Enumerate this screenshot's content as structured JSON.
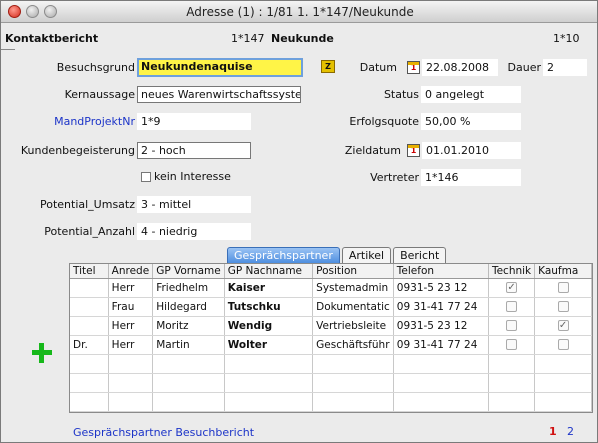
{
  "window": {
    "title": "Adresse (1) : 1/81 1.  1*147/Neukunde"
  },
  "header": {
    "section": "Kontaktbericht",
    "record": "1*147",
    "kind": "Neukunde",
    "counter": "1*10"
  },
  "form": {
    "besuchsgrund": {
      "label": "Besuchsgrund",
      "value": "Neukundenaquise"
    },
    "kernaussage": {
      "label": "Kernaussage",
      "value": "neues Warenwirtschaftssystem"
    },
    "mandprojekt": {
      "label": "MandProjektNr",
      "value": "1*9"
    },
    "kundenbegeisterung": {
      "label": "Kundenbegeisterung",
      "value": "2 - hoch"
    },
    "kein_interesse": {
      "label": "kein Interesse"
    },
    "potential_umsatz": {
      "label": "Potential_Umsatz",
      "value": "3 - mittel"
    },
    "potential_anzahl": {
      "label": "Potential_Anzahl",
      "value": "4 - niedrig"
    },
    "datum": {
      "label": "Datum",
      "value": "22.08.2008"
    },
    "dauer": {
      "label": "Dauer",
      "value": "2"
    },
    "status": {
      "label": "Status",
      "value": "0 angelegt"
    },
    "erfolgsquote": {
      "label": "Erfolgsquote",
      "value": "50,00 %"
    },
    "zieldatum": {
      "label": "Zieldatum",
      "value": "01.01.2010"
    },
    "vertreter": {
      "label": "Vertreter",
      "value": "1*146"
    },
    "cal_glyph": "1"
  },
  "tabs": [
    "Gesprächspartner",
    "Artikel",
    "Bericht"
  ],
  "table": {
    "columns": [
      "Titel",
      "Anrede",
      "GP Vorname",
      "GP Nachname",
      "Position",
      "Telefon",
      "Technik",
      "Kaufma"
    ],
    "rows": [
      {
        "titel": "",
        "anrede": "Herr",
        "vorname": "Friedhelm",
        "nachname": "Kaiser",
        "position": "Systemadmin",
        "telefon": "0931-5 23 12",
        "technik": true,
        "kauf": false
      },
      {
        "titel": "",
        "anrede": "Frau",
        "vorname": "Hildegard",
        "nachname": "Tutschku",
        "position": "Dokumentatic",
        "telefon": "09 31-41 77 24",
        "technik": false,
        "kauf": false
      },
      {
        "titel": "",
        "anrede": "Herr",
        "vorname": "Moritz",
        "nachname": "Wendig",
        "position": "Vertriebsleite",
        "telefon": "0931-5 23 12",
        "technik": false,
        "kauf": true
      },
      {
        "titel": "Dr.",
        "anrede": "Herr",
        "vorname": "Martin",
        "nachname": "Wolter",
        "position": "Geschäftsführ",
        "telefon": "09 31-41 77 24",
        "technik": false,
        "kauf": false
      }
    ]
  },
  "footer": {
    "link": "Gesprächspartner Besuchbericht",
    "page1": "1",
    "page2": "2"
  },
  "icons": {
    "plus": "add-icon",
    "calendar": "calendar-icon",
    "lookup": "lookup-icon"
  },
  "colors": {
    "accent_blue": "#1c34c8",
    "highlight_yellow": "#fff447",
    "add_green": "#16b81a",
    "page_red": "#d01010"
  }
}
